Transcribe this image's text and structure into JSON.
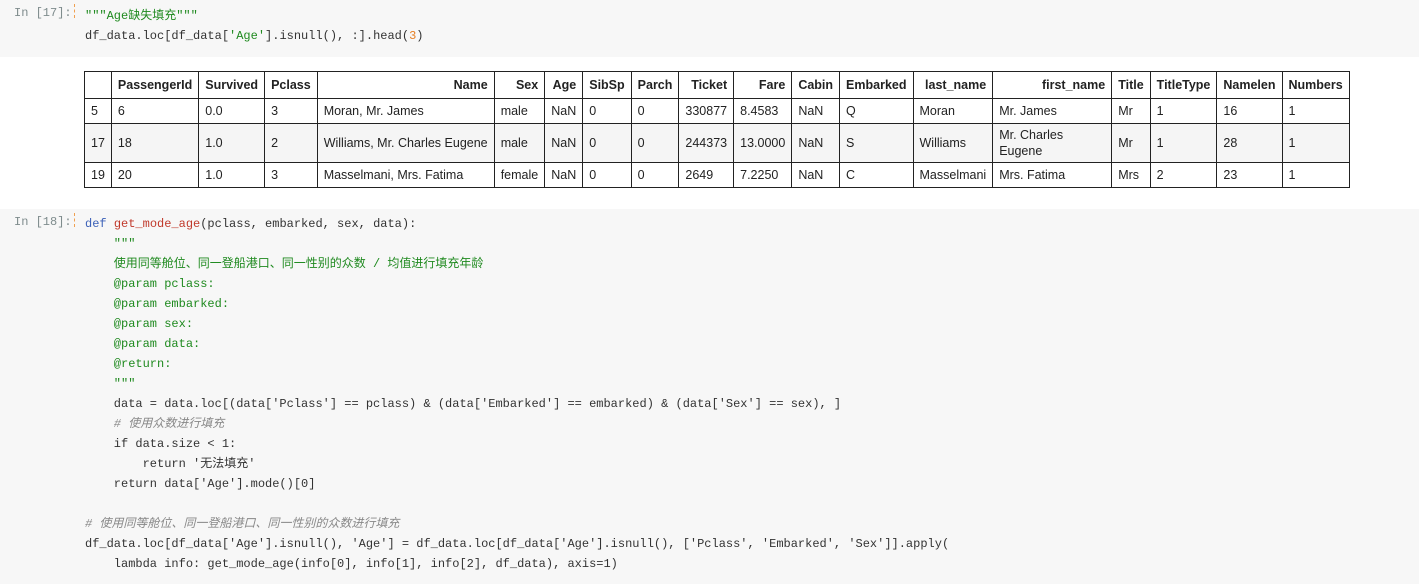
{
  "cell17": {
    "prompt": "In [17]:",
    "line1": "\"\"\"Age缺失填充\"\"\"",
    "line2_a": "df_data.loc[df_data[",
    "line2_s1": "'Age'",
    "line2_b": "].isnull(), :].head(",
    "line2_n": "3",
    "line2_c": ")"
  },
  "table": {
    "columns": [
      "",
      "PassengerId",
      "Survived",
      "Pclass",
      "Name",
      "Sex",
      "Age",
      "SibSp",
      "Parch",
      "Ticket",
      "Fare",
      "Cabin",
      "Embarked",
      "last_name",
      "first_name",
      "Title",
      "TitleType",
      "Namelen",
      "Numbers"
    ],
    "rows": [
      [
        "5",
        "6",
        "0.0",
        "3",
        "Moran, Mr. James",
        "male",
        "NaN",
        "0",
        "0",
        "330877",
        "8.4583",
        "NaN",
        "Q",
        "Moran",
        "Mr. James",
        "Mr",
        "1",
        "16",
        "1"
      ],
      [
        "17",
        "18",
        "1.0",
        "2",
        "Williams, Mr. Charles Eugene",
        "male",
        "NaN",
        "0",
        "0",
        "244373",
        "13.0000",
        "NaN",
        "S",
        "Williams",
        "Mr. Charles Eugene",
        "Mr",
        "1",
        "28",
        "1"
      ],
      [
        "19",
        "20",
        "1.0",
        "3",
        "Masselmani, Mrs. Fatima",
        "female",
        "NaN",
        "0",
        "0",
        "2649",
        "7.2250",
        "NaN",
        "C",
        "Masselmani",
        "Mrs. Fatima",
        "Mrs",
        "2",
        "23",
        "1"
      ]
    ]
  },
  "cell18": {
    "prompt": "In [18]:",
    "def_kw": "def",
    "def_name": "get_mode_age",
    "def_args": "(pclass, embarked, sex, data):",
    "doc_open": "    \"\"\"",
    "doc_line": "    使用同等舱位、同一登船港口、同一性别的众数 / 均值进行填充年龄",
    "param1": "    @param pclass:",
    "param2": "    @param embarked:",
    "param3": "    @param sex:",
    "param4": "    @param data:",
    "ret": "    @return:",
    "doc_close": "    \"\"\"",
    "assign_line": "    data = data.loc[(data['Pclass'] == pclass) & (data['Embarked'] == embarked) & (data['Sex'] == sex), ]",
    "comment1": "    # 使用众数进行填充",
    "if_line": "    if data.size < 1:",
    "return1": "        return '无法填充'",
    "return2": "    return data['Age'].mode()[0]",
    "comment2": "# 使用同等舱位、同一登船港口、同一性别的众数进行填充",
    "apply_line": "df_data.loc[df_data['Age'].isnull(), 'Age'] = df_data.loc[df_data['Age'].isnull(), ['Pclass', 'Embarked', 'Sex']].apply(",
    "lambda_line": "    lambda info: get_mode_age(info[0], info[1], info[2], df_data), axis=1)"
  }
}
